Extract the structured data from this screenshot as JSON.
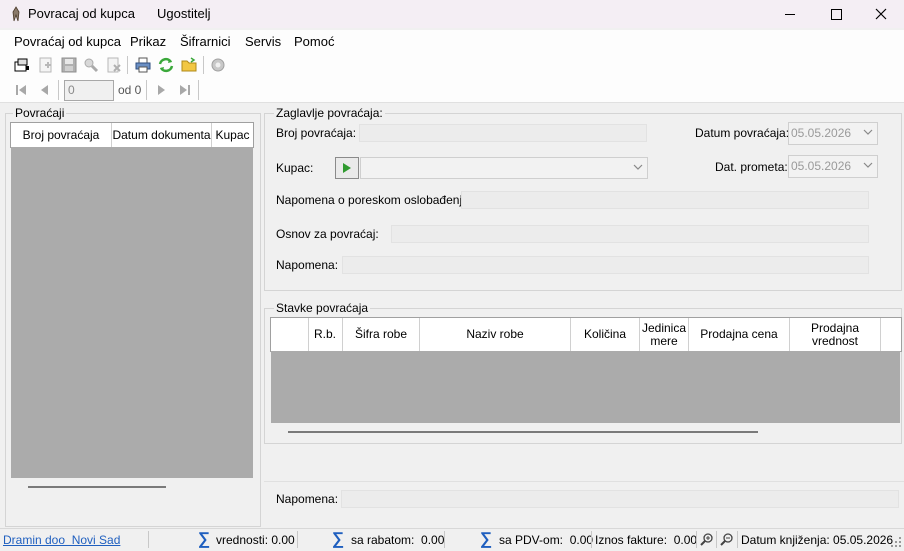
{
  "window": {
    "title": "Povracaj od kupca",
    "subtitle": "Ugostitelj"
  },
  "menu": [
    "Povraćaj od kupca",
    "Prikaz",
    "Šifrarnici",
    "Servis",
    "Pomoć"
  ],
  "nav": {
    "position": "0",
    "of_label": "od 0"
  },
  "left_panel": {
    "title": "Povraćaji",
    "columns": [
      "Broj povraćaja",
      "Datum dokumenta",
      "Kupac"
    ]
  },
  "header": {
    "title": "Zaglavlje povraćaja:",
    "broj_label": "Broj povraćaja:",
    "datum_label": "Datum povraćaja:",
    "datum_value": "05.05.2026",
    "kupac_label": "Kupac:",
    "dat_prometa_label": "Dat. prometa:",
    "dat_prometa_value": "05.05.2026",
    "napomena_porez_label": "Napomena o poreskom oslobađenju:",
    "osnov_label": "Osnov za povraćaj:",
    "napomena_label": "Napomena:"
  },
  "items": {
    "title": "Stavke povraćaja",
    "columns": [
      "R.b.",
      "Šifra robe",
      "Naziv robe",
      "Količina",
      "Jedinica mere",
      "Prodajna cena",
      "Prodajna vrednost"
    ]
  },
  "footer": {
    "napomena_label": "Napomena:"
  },
  "status": {
    "company": "Dramin doo  Novi Sad",
    "vrednosti": "vrednosti: 0.00",
    "sa_rabatom": "sa rabatom:  0.00",
    "sa_pdv": "sa PDV-om:  0.00",
    "iznos": "Iznos fakture:  0.00",
    "datum_knjizenja": "Datum knjiženja: 05.05.2026"
  },
  "colors": {
    "accent": "#1f5fbf",
    "grid_body": "#ababab",
    "title_bg": "#f4eef4"
  }
}
